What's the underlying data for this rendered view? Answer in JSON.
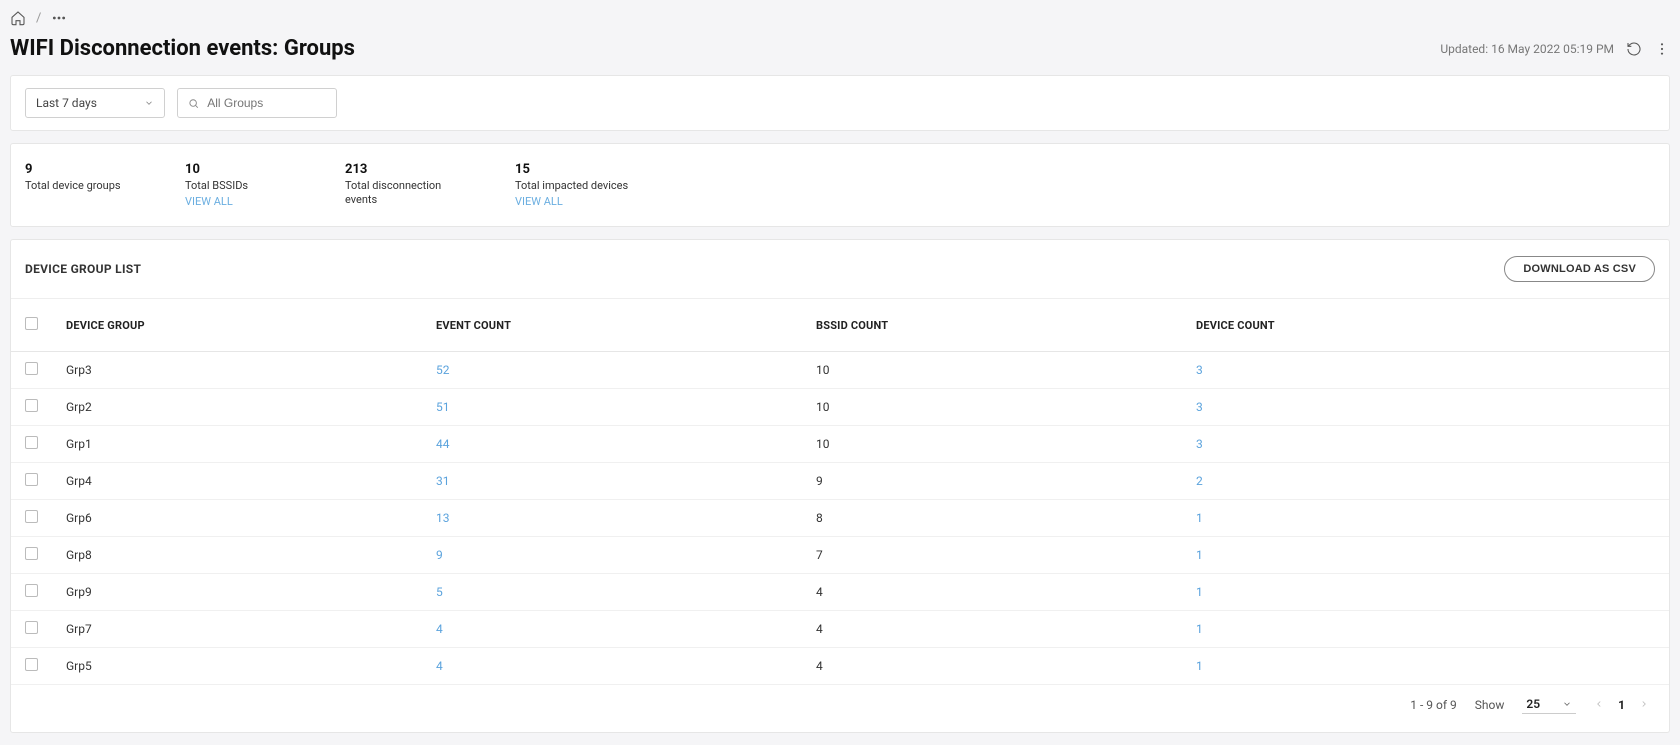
{
  "breadcrumb": {
    "sep": "/"
  },
  "header": {
    "title": "WIFI Disconnection events: Groups",
    "updated_prefix": "Updated:",
    "updated_time": "16 May 2022 05:19 PM"
  },
  "filters": {
    "time_range": "Last 7 days",
    "search_placeholder": "All Groups"
  },
  "stats": {
    "device_groups": {
      "value": "9",
      "label": "Total device groups"
    },
    "bssids": {
      "value": "10",
      "label": "Total BSSIDs",
      "view_all": "VIEW ALL"
    },
    "disconnections": {
      "value": "213",
      "label": "Total disconnection events"
    },
    "impacted": {
      "value": "15",
      "label": "Total impacted devices",
      "view_all": "VIEW ALL"
    }
  },
  "table": {
    "title": "DEVICE GROUP LIST",
    "download_label": "DOWNLOAD AS CSV",
    "columns": {
      "name": "DEVICE GROUP",
      "event": "EVENT COUNT",
      "bssid": "BSSID COUNT",
      "device": "DEVICE COUNT"
    },
    "rows": [
      {
        "name": "Grp3",
        "event": "52",
        "bssid": "10",
        "device": "3"
      },
      {
        "name": "Grp2",
        "event": "51",
        "bssid": "10",
        "device": "3"
      },
      {
        "name": "Grp1",
        "event": "44",
        "bssid": "10",
        "device": "3"
      },
      {
        "name": "Grp4",
        "event": "31",
        "bssid": "9",
        "device": "2"
      },
      {
        "name": "Grp6",
        "event": "13",
        "bssid": "8",
        "device": "1"
      },
      {
        "name": "Grp8",
        "event": "9",
        "bssid": "7",
        "device": "1"
      },
      {
        "name": "Grp9",
        "event": "5",
        "bssid": "4",
        "device": "1"
      },
      {
        "name": "Grp7",
        "event": "4",
        "bssid": "4",
        "device": "1"
      },
      {
        "name": "Grp5",
        "event": "4",
        "bssid": "4",
        "device": "1"
      }
    ]
  },
  "pagination": {
    "range": "1 - 9 of 9",
    "show_label": "Show",
    "page_size": "25",
    "current_page": "1"
  }
}
